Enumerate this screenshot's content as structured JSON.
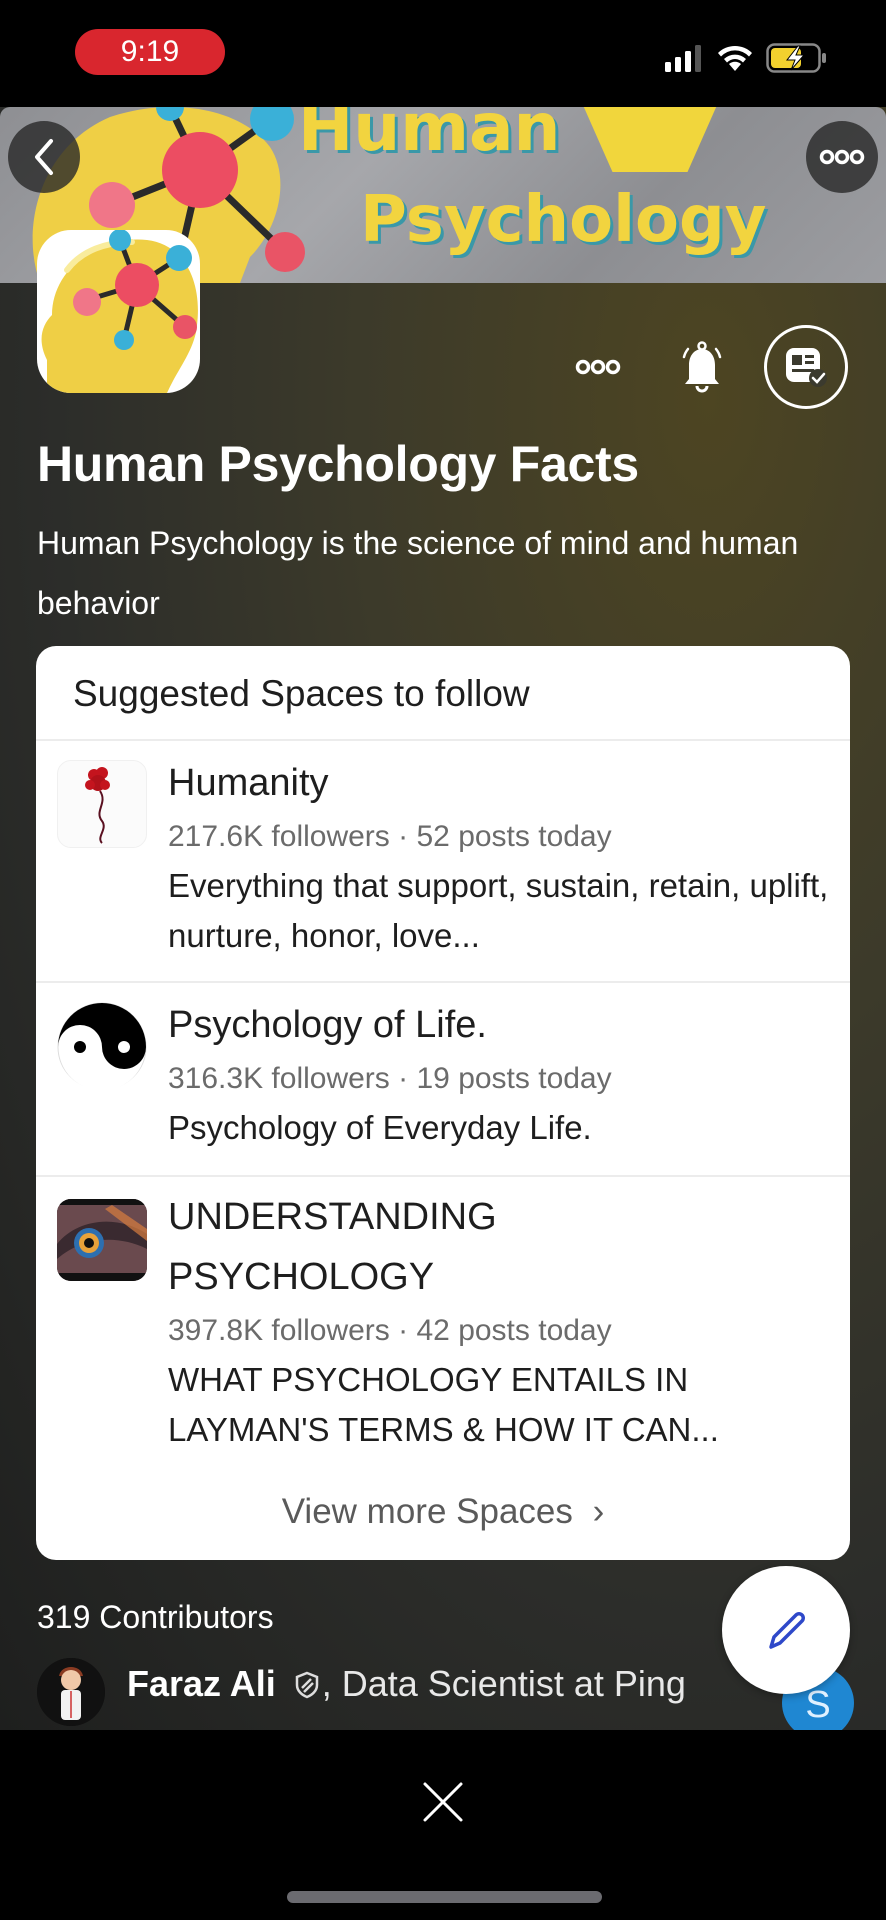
{
  "status_bar": {
    "time": "9:19",
    "icons": [
      "cellular-signal-icon",
      "wifi-icon",
      "battery-charging-icon"
    ],
    "time_pill_color": "#d9262e"
  },
  "banner": {
    "line1": "Human",
    "line2": "Psychology",
    "back_icon": "chevron-left-icon",
    "more_icon": "more-horizontal-icon"
  },
  "space": {
    "name": "Human Psychology Facts",
    "description": "Human Psychology is the science of mind and human behavior",
    "actions": {
      "more_icon": "more-horizontal-icon",
      "notify_icon": "bell-icon",
      "follow_icon": "following-check-icon"
    }
  },
  "suggested": {
    "header": "Suggested Spaces to follow",
    "items": [
      {
        "name": "Humanity",
        "followers": "217.6K followers",
        "posts": "52 posts today",
        "separator": "·",
        "description": "Everything that support, sustain, retain, uplift, nurture, honor, love..."
      },
      {
        "name": "Psychology of Life.",
        "followers": "316.3K followers",
        "posts": "19 posts today",
        "separator": "·",
        "description": "Psychology of Everyday Life."
      },
      {
        "name": "UNDERSTANDING PSYCHOLOGY",
        "followers": "397.8K followers",
        "posts": "42 posts today",
        "separator": "·",
        "description": "WHAT PSYCHOLOGY ENTAILS IN LAYMAN'S TERMS & HOW IT CAN..."
      }
    ],
    "view_more": "View more Spaces",
    "view_more_chevron": "›"
  },
  "contributors": {
    "title": "319 Contributors",
    "first": {
      "name": "Faraz Ali",
      "credential": ", Data Scientist at Ping",
      "badge_icon": "shield-icon"
    },
    "second_initial": "S"
  },
  "fab": {
    "icon": "pencil-icon",
    "color": "#2e48c9"
  },
  "bottom": {
    "close_icon": "close-icon"
  }
}
